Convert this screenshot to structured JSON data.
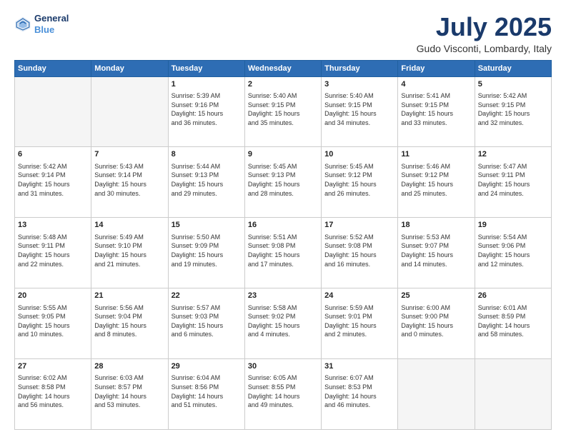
{
  "header": {
    "logo_line1": "General",
    "logo_line2": "Blue",
    "title": "July 2025",
    "subtitle": "Gudo Visconti, Lombardy, Italy"
  },
  "columns": [
    "Sunday",
    "Monday",
    "Tuesday",
    "Wednesday",
    "Thursday",
    "Friday",
    "Saturday"
  ],
  "weeks": [
    [
      {
        "day": "",
        "info": ""
      },
      {
        "day": "",
        "info": ""
      },
      {
        "day": "1",
        "info": "Sunrise: 5:39 AM\nSunset: 9:16 PM\nDaylight: 15 hours\nand 36 minutes."
      },
      {
        "day": "2",
        "info": "Sunrise: 5:40 AM\nSunset: 9:15 PM\nDaylight: 15 hours\nand 35 minutes."
      },
      {
        "day": "3",
        "info": "Sunrise: 5:40 AM\nSunset: 9:15 PM\nDaylight: 15 hours\nand 34 minutes."
      },
      {
        "day": "4",
        "info": "Sunrise: 5:41 AM\nSunset: 9:15 PM\nDaylight: 15 hours\nand 33 minutes."
      },
      {
        "day": "5",
        "info": "Sunrise: 5:42 AM\nSunset: 9:15 PM\nDaylight: 15 hours\nand 32 minutes."
      }
    ],
    [
      {
        "day": "6",
        "info": "Sunrise: 5:42 AM\nSunset: 9:14 PM\nDaylight: 15 hours\nand 31 minutes."
      },
      {
        "day": "7",
        "info": "Sunrise: 5:43 AM\nSunset: 9:14 PM\nDaylight: 15 hours\nand 30 minutes."
      },
      {
        "day": "8",
        "info": "Sunrise: 5:44 AM\nSunset: 9:13 PM\nDaylight: 15 hours\nand 29 minutes."
      },
      {
        "day": "9",
        "info": "Sunrise: 5:45 AM\nSunset: 9:13 PM\nDaylight: 15 hours\nand 28 minutes."
      },
      {
        "day": "10",
        "info": "Sunrise: 5:45 AM\nSunset: 9:12 PM\nDaylight: 15 hours\nand 26 minutes."
      },
      {
        "day": "11",
        "info": "Sunrise: 5:46 AM\nSunset: 9:12 PM\nDaylight: 15 hours\nand 25 minutes."
      },
      {
        "day": "12",
        "info": "Sunrise: 5:47 AM\nSunset: 9:11 PM\nDaylight: 15 hours\nand 24 minutes."
      }
    ],
    [
      {
        "day": "13",
        "info": "Sunrise: 5:48 AM\nSunset: 9:11 PM\nDaylight: 15 hours\nand 22 minutes."
      },
      {
        "day": "14",
        "info": "Sunrise: 5:49 AM\nSunset: 9:10 PM\nDaylight: 15 hours\nand 21 minutes."
      },
      {
        "day": "15",
        "info": "Sunrise: 5:50 AM\nSunset: 9:09 PM\nDaylight: 15 hours\nand 19 minutes."
      },
      {
        "day": "16",
        "info": "Sunrise: 5:51 AM\nSunset: 9:08 PM\nDaylight: 15 hours\nand 17 minutes."
      },
      {
        "day": "17",
        "info": "Sunrise: 5:52 AM\nSunset: 9:08 PM\nDaylight: 15 hours\nand 16 minutes."
      },
      {
        "day": "18",
        "info": "Sunrise: 5:53 AM\nSunset: 9:07 PM\nDaylight: 15 hours\nand 14 minutes."
      },
      {
        "day": "19",
        "info": "Sunrise: 5:54 AM\nSunset: 9:06 PM\nDaylight: 15 hours\nand 12 minutes."
      }
    ],
    [
      {
        "day": "20",
        "info": "Sunrise: 5:55 AM\nSunset: 9:05 PM\nDaylight: 15 hours\nand 10 minutes."
      },
      {
        "day": "21",
        "info": "Sunrise: 5:56 AM\nSunset: 9:04 PM\nDaylight: 15 hours\nand 8 minutes."
      },
      {
        "day": "22",
        "info": "Sunrise: 5:57 AM\nSunset: 9:03 PM\nDaylight: 15 hours\nand 6 minutes."
      },
      {
        "day": "23",
        "info": "Sunrise: 5:58 AM\nSunset: 9:02 PM\nDaylight: 15 hours\nand 4 minutes."
      },
      {
        "day": "24",
        "info": "Sunrise: 5:59 AM\nSunset: 9:01 PM\nDaylight: 15 hours\nand 2 minutes."
      },
      {
        "day": "25",
        "info": "Sunrise: 6:00 AM\nSunset: 9:00 PM\nDaylight: 15 hours\nand 0 minutes."
      },
      {
        "day": "26",
        "info": "Sunrise: 6:01 AM\nSunset: 8:59 PM\nDaylight: 14 hours\nand 58 minutes."
      }
    ],
    [
      {
        "day": "27",
        "info": "Sunrise: 6:02 AM\nSunset: 8:58 PM\nDaylight: 14 hours\nand 56 minutes."
      },
      {
        "day": "28",
        "info": "Sunrise: 6:03 AM\nSunset: 8:57 PM\nDaylight: 14 hours\nand 53 minutes."
      },
      {
        "day": "29",
        "info": "Sunrise: 6:04 AM\nSunset: 8:56 PM\nDaylight: 14 hours\nand 51 minutes."
      },
      {
        "day": "30",
        "info": "Sunrise: 6:05 AM\nSunset: 8:55 PM\nDaylight: 14 hours\nand 49 minutes."
      },
      {
        "day": "31",
        "info": "Sunrise: 6:07 AM\nSunset: 8:53 PM\nDaylight: 14 hours\nand 46 minutes."
      },
      {
        "day": "",
        "info": ""
      },
      {
        "day": "",
        "info": ""
      }
    ]
  ]
}
